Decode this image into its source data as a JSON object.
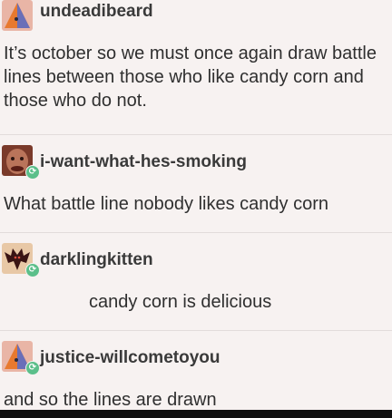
{
  "posts": [
    {
      "username": "undeadibeard",
      "text": "It’s october so we must once again draw battle lines between those who like candy corn and those who do not."
    },
    {
      "username": "i-want-what-hes-smoking",
      "text": "What battle line nobody likes candy corn"
    },
    {
      "username": "darklingkitten",
      "text": "candy corn is delicious"
    },
    {
      "username": "justice-willcometoyou",
      "text": "and so the lines are drawn"
    }
  ],
  "icons": {
    "avatar_1": "triangle-avatar-icon",
    "avatar_2": "face-avatar-icon",
    "avatar_3": "bat-avatar-icon",
    "avatar_4": "triangle-avatar-icon",
    "reblog": "reblog-icon"
  },
  "colors": {
    "background": "#f7f2f1",
    "reblog_badge": "#5bbf8a",
    "text": "#2f2f2f"
  }
}
